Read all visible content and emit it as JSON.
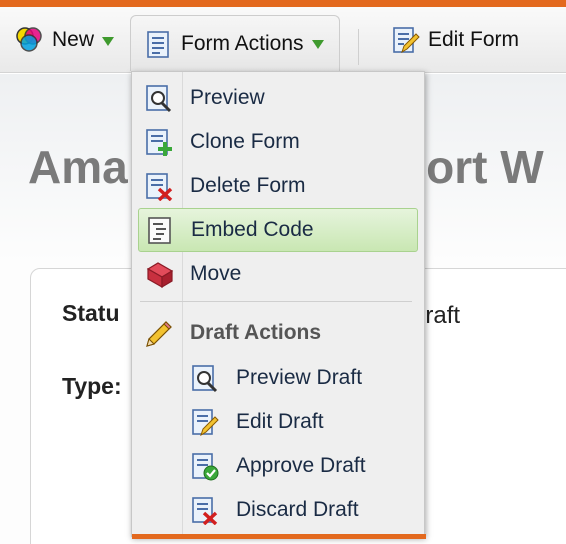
{
  "toolbar": {
    "new_label": "New",
    "form_actions_label": "Form Actions",
    "edit_form_label": "Edit Form"
  },
  "page": {
    "title_left": "Ama",
    "title_right": "port W",
    "status_label": "Statu",
    "status_value": "draft",
    "type_label": "Type:"
  },
  "menu": {
    "items": [
      {
        "label": "Preview",
        "icon": "preview-icon"
      },
      {
        "label": "Clone Form",
        "icon": "clone-icon"
      },
      {
        "label": "Delete Form",
        "icon": "delete-icon"
      },
      {
        "label": "Embed Code",
        "icon": "embed-code-icon",
        "selected": true
      },
      {
        "label": "Move",
        "icon": "move-icon"
      }
    ],
    "group_header": "Draft Actions",
    "draft_items": [
      {
        "label": "Preview Draft",
        "icon": "preview-icon"
      },
      {
        "label": "Edit Draft",
        "icon": "edit-icon"
      },
      {
        "label": "Approve Draft",
        "icon": "approve-icon"
      },
      {
        "label": "Discard Draft",
        "icon": "discard-icon"
      }
    ]
  },
  "colors": {
    "accent_orange": "#e3691e",
    "caret_green": "#3f9a2e",
    "selected_bg": "#c9e7b3"
  }
}
